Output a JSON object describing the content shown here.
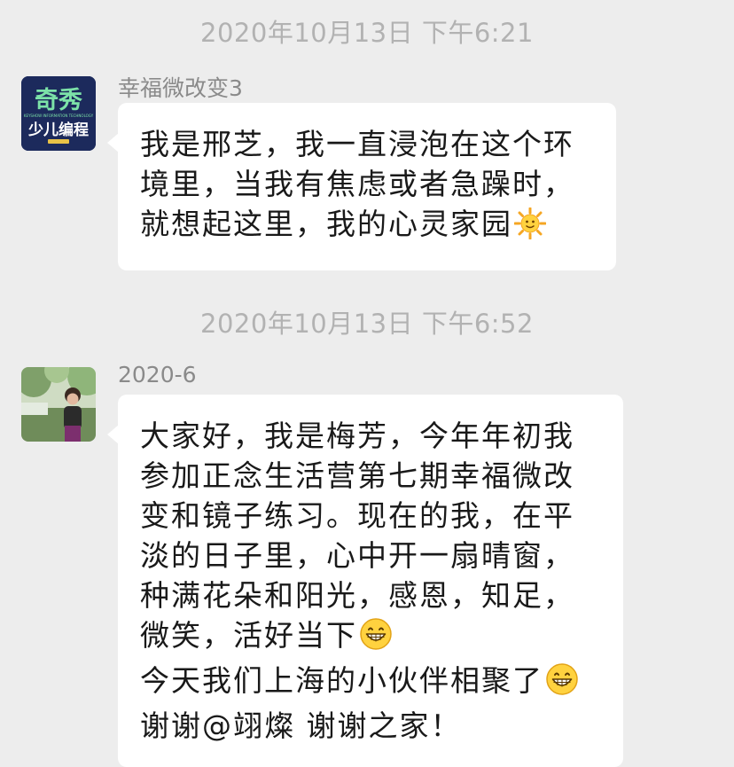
{
  "messages": [
    {
      "timestamp": "2020年10月13日 下午6:21",
      "sender": "幸福微改变3",
      "avatar_icon": "kids-coding-logo",
      "avatar_texts": [
        "奇秀",
        "KEYSHOW INFORMATION TECHNOLOGY",
        "少儿编程"
      ],
      "lines": [
        "我是邢芝，我一直浸泡在这个环",
        "境里，当我有焦虑或者急躁时，",
        "就想起这里，我的心灵家园"
      ],
      "emoji": "sun-with-face-emoji"
    },
    {
      "timestamp": "2020年10月13日 下午6:52",
      "sender": "2020-6",
      "avatar_icon": "person-photo",
      "lines": [
        "大家好，我是梅芳，今年年初我",
        "参加正念生活营第七期幸福微改",
        "变和镜子练习。现在的我，在平",
        "淡的日子里，心中开一扇晴窗，",
        "种满花朵和阳光，感恩，知足，",
        "微笑，活好当下",
        "今天我们上海的小伙伴相聚了",
        "谢谢@翊燦 谢谢之家！"
      ],
      "emoji": "grinning-face-emoji"
    }
  ],
  "colors": {
    "background": "#ededed",
    "bubble": "#ffffff",
    "timestamp_text": "#b2b2b2",
    "sender_text": "#8a8a8a",
    "message_text": "#191919",
    "logo_bg": "#1c2a5c",
    "logo_green": "#7ce2a8"
  }
}
